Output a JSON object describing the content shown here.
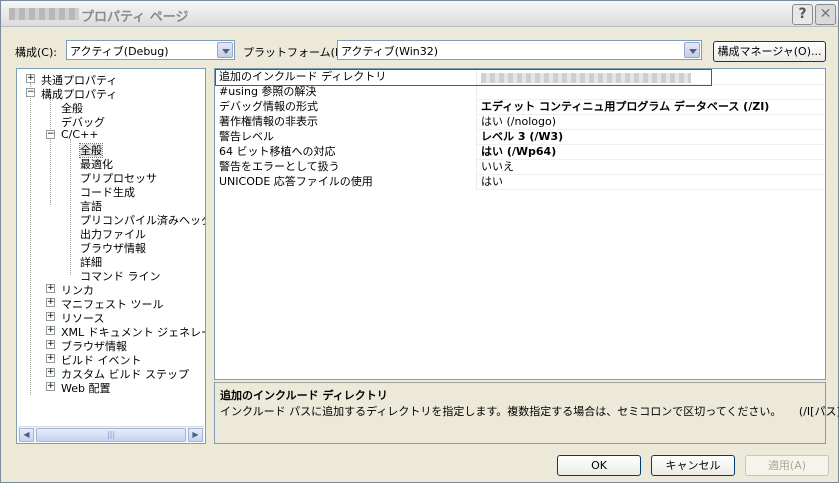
{
  "window": {
    "title": "プロパティ ページ",
    "help_glyph": "?",
    "close_glyph": "✕"
  },
  "toolbar": {
    "config_label": "構成(C):",
    "config_value": "アクティブ(Debug)",
    "platform_label": "プラットフォーム(P):",
    "platform_value": "アクティブ(Win32)",
    "config_manager_label": "構成マネージャ(O)..."
  },
  "tree": {
    "items": [
      {
        "label": "共通プロパティ",
        "expander": "+"
      },
      {
        "label": "構成プロパティ",
        "expander": "−"
      },
      {
        "label": "全般"
      },
      {
        "label": "デバッグ"
      },
      {
        "label": "C/C++",
        "expander": "−"
      },
      {
        "label": "全般",
        "selected": true
      },
      {
        "label": "最適化"
      },
      {
        "label": "プリプロセッサ"
      },
      {
        "label": "コード生成"
      },
      {
        "label": "言語"
      },
      {
        "label": "プリコンパイル済みヘッダー"
      },
      {
        "label": "出力ファイル"
      },
      {
        "label": "ブラウザ情報"
      },
      {
        "label": "詳細"
      },
      {
        "label": "コマンド ライン"
      },
      {
        "label": "リンカ",
        "expander": "+"
      },
      {
        "label": "マニフェスト ツール",
        "expander": "+"
      },
      {
        "label": "リソース",
        "expander": "+"
      },
      {
        "label": "XML ドキュメント ジェネレータ",
        "expander": "+"
      },
      {
        "label": "ブラウザ情報",
        "expander": "+"
      },
      {
        "label": "ビルド イベント",
        "expander": "+"
      },
      {
        "label": "カスタム ビルド ステップ",
        "expander": "+"
      },
      {
        "label": "Web 配置",
        "expander": "+"
      }
    ],
    "scroll_left": "◀",
    "scroll_right": "▶",
    "scroll_grip": "|||"
  },
  "properties": [
    {
      "name": "追加のインクルード ディレクトリ",
      "value": "",
      "bold": false,
      "blurred": true
    },
    {
      "name": "#using 参照の解決",
      "value": "",
      "bold": false
    },
    {
      "name": "デバッグ情報の形式",
      "value": "エディット コンティニュ用プログラム データベース (/ZI)",
      "bold": true
    },
    {
      "name": "著作権情報の非表示",
      "value": "はい (/nologo)",
      "bold": false
    },
    {
      "name": "警告レベル",
      "value": "レベル 3 (/W3)",
      "bold": true
    },
    {
      "name": "64 ビット移植への対応",
      "value": "はい (/Wp64)",
      "bold": true
    },
    {
      "name": "警告をエラーとして扱う",
      "value": "いいえ",
      "bold": false
    },
    {
      "name": "UNICODE 応答ファイルの使用",
      "value": "はい",
      "bold": false
    }
  ],
  "description": {
    "title": "追加のインクルード ディレクトリ",
    "text": "インクルード パスに追加するディレクトリを指定します。複数指定する場合は、セミコロンで区切ってください。",
    "switch": "(/I[パス])"
  },
  "buttons": {
    "ok": "OK",
    "cancel": "キャンセル",
    "apply": "適用(A)"
  },
  "colors": {
    "highlight_border": "#e02020",
    "window_bg": "#ece9d8"
  }
}
